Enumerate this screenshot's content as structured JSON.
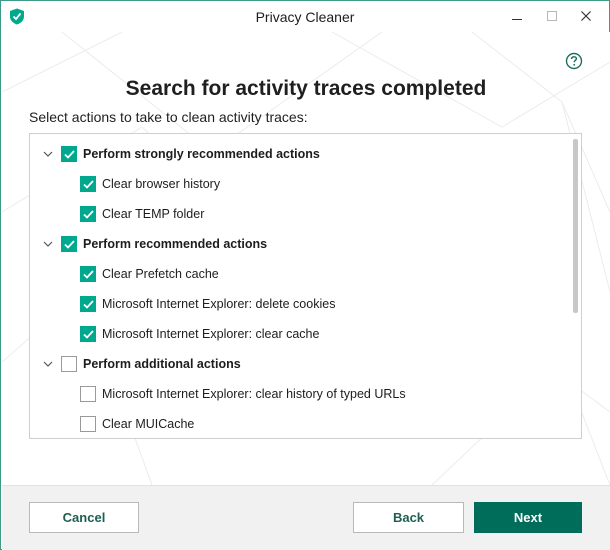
{
  "window": {
    "title": "Privacy Cleaner",
    "controls": [
      "minimize",
      "maximize",
      "close"
    ]
  },
  "page": {
    "heading": "Search for activity traces completed",
    "instruction": "Select actions to take to clean activity traces:",
    "help_icon": "help-circle-icon"
  },
  "actions": {
    "groups": [
      {
        "label": "Perform strongly recommended actions",
        "checked": true,
        "expanded": true,
        "items": [
          {
            "label": "Clear browser history",
            "checked": true
          },
          {
            "label": "Clear TEMP folder",
            "checked": true
          }
        ]
      },
      {
        "label": "Perform recommended actions",
        "checked": true,
        "expanded": true,
        "items": [
          {
            "label": "Clear Prefetch cache",
            "checked": true
          },
          {
            "label": "Microsoft Internet Explorer: delete cookies",
            "checked": true
          },
          {
            "label": "Microsoft Internet Explorer: clear cache",
            "checked": true
          }
        ]
      },
      {
        "label": "Perform additional actions",
        "checked": false,
        "expanded": true,
        "items": [
          {
            "label": "Microsoft Internet Explorer: clear history of typed URLs",
            "checked": false
          },
          {
            "label": "Clear MUICache",
            "checked": false
          }
        ]
      }
    ]
  },
  "footer": {
    "cancel_label": "Cancel",
    "back_label": "Back",
    "next_label": "Next"
  },
  "colors": {
    "accent": "#00a88e",
    "primary_button": "#006d5b",
    "button_text": "#1e5e52",
    "footer_bg": "#f1f1f1"
  }
}
